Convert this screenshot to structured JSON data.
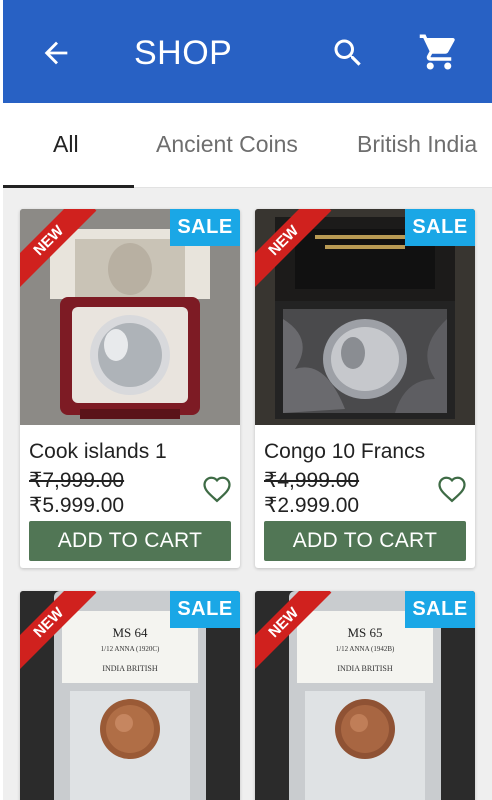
{
  "appbar": {
    "title": "SHOP",
    "background_color": "#2861c4",
    "back_icon": "arrow-back-icon",
    "search_icon": "search-icon",
    "cart_icon": "shopping-cart-icon"
  },
  "tabs": [
    {
      "label": "All",
      "active": true
    },
    {
      "label": "Ancient Coins",
      "active": false
    },
    {
      "label": "British India",
      "active": false
    }
  ],
  "products": [
    {
      "name": "Cook islands 1",
      "old_price": "₹7,999.00",
      "new_price": "₹5,999.00",
      "badge_new": "NEW",
      "badge_sale": "SALE",
      "button": "ADD TO CART",
      "image": "silver coin in red velvet box with portrait card"
    },
    {
      "name": "Congo 10 Francs",
      "old_price": "₹4,999.00",
      "new_price": "₹2,999.00",
      "badge_new": "NEW",
      "badge_sale": "SALE",
      "button": "ADD TO CART",
      "image": "clear oval coin in black satin case"
    },
    {
      "name": "",
      "old_price": "",
      "new_price": "",
      "badge_new": "NEW",
      "badge_sale": "SALE",
      "button": "",
      "image": "graded copper coin slab",
      "slab": {
        "grade": "MS 64",
        "line1": "1/12 ANNA (1920C)",
        "line3": "INDIA BRITISH"
      }
    },
    {
      "name": "",
      "old_price": "",
      "new_price": "",
      "badge_new": "NEW",
      "badge_sale": "SALE",
      "button": "",
      "image": "graded copper coin slab",
      "slab": {
        "grade": "MS 65",
        "line1": "1/12 ANNA (1942B)",
        "line3": "INDIA BRITISH"
      }
    }
  ],
  "colors": {
    "sale_badge": "#1aa7e6",
    "new_ribbon": "#d0211e",
    "add_to_cart": "#517655"
  }
}
